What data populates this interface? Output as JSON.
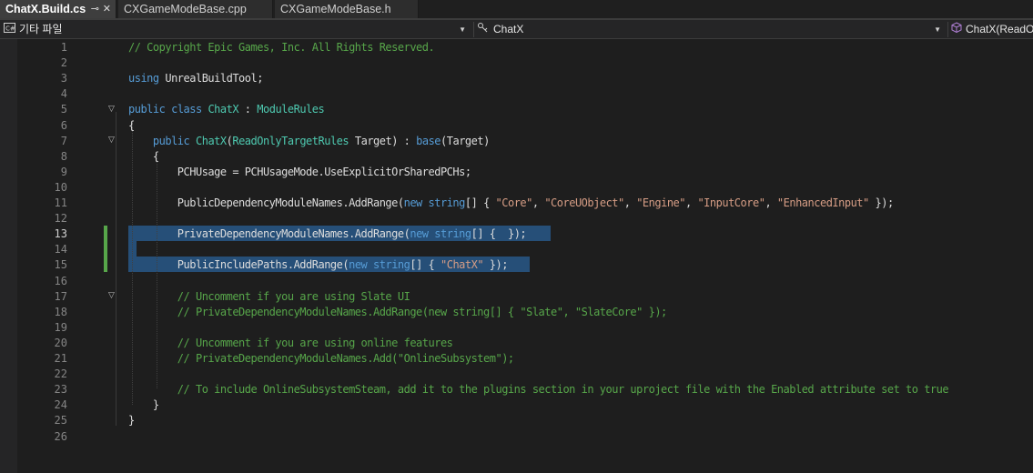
{
  "tabs": [
    {
      "label": "ChatX.Build.cs",
      "active": true,
      "pin": "⊸",
      "close": "✕"
    },
    {
      "label": "CXGameModeBase.cpp",
      "active": false
    },
    {
      "label": "CXGameModeBase.h",
      "active": false
    }
  ],
  "navbar": {
    "project": "기타 파일",
    "class_scope": "ChatX",
    "member_scope": "ChatX(ReadOnlyTargetRules Target)"
  },
  "editor": {
    "current_line": 13,
    "lines": [
      {
        "n": "1",
        "text": "// Copyright Epic Games, Inc. All Rights Reserved."
      },
      {
        "n": "2",
        "text": ""
      },
      {
        "n": "3",
        "text": "using UnrealBuildTool;"
      },
      {
        "n": "4",
        "text": ""
      },
      {
        "n": "5",
        "text": "public class ChatX : ModuleRules"
      },
      {
        "n": "6",
        "text": "{"
      },
      {
        "n": "7",
        "text": "    public ChatX(ReadOnlyTargetRules Target) : base(Target)"
      },
      {
        "n": "8",
        "text": "    {"
      },
      {
        "n": "9",
        "text": "        PCHUsage = PCHUsageMode.UseExplicitOrSharedPCHs;"
      },
      {
        "n": "10",
        "text": ""
      },
      {
        "n": "11",
        "text": "        PublicDependencyModuleNames.AddRange(new string[] { \"Core\", \"CoreUObject\", \"Engine\", \"InputCore\", \"EnhancedInput\" });"
      },
      {
        "n": "12",
        "text": ""
      },
      {
        "n": "13",
        "text": "        PrivateDependencyModuleNames.AddRange(new string[] {  });"
      },
      {
        "n": "14",
        "text": ""
      },
      {
        "n": "15",
        "text": "        PublicIncludePaths.AddRange(new string[] { \"ChatX\" });"
      },
      {
        "n": "16",
        "text": ""
      },
      {
        "n": "17",
        "text": "        // Uncomment if you are using Slate UI"
      },
      {
        "n": "18",
        "text": "        // PrivateDependencyModuleNames.AddRange(new string[] { \"Slate\", \"SlateCore\" });"
      },
      {
        "n": "19",
        "text": ""
      },
      {
        "n": "20",
        "text": "        // Uncomment if you are using online features"
      },
      {
        "n": "21",
        "text": "        // PrivateDependencyModuleNames.Add(\"OnlineSubsystem\");"
      },
      {
        "n": "22",
        "text": ""
      },
      {
        "n": "23",
        "text": "        // To include OnlineSubsystemSteam, add it to the plugins section in your uproject file with the Enabled attribute set to true"
      },
      {
        "n": "24",
        "text": "    }"
      },
      {
        "n": "25",
        "text": "}"
      },
      {
        "n": "26",
        "text": ""
      }
    ]
  },
  "icons": {
    "project": "csharp-project-icon",
    "class_scope": "class-icon",
    "member_scope": "method-icon"
  },
  "colors": {
    "keyword": "#569cd6",
    "type": "#4ec9b0",
    "string": "#d69d85",
    "comment": "#57a64a",
    "selection": "#264f78",
    "change_bar": "#57a64a"
  }
}
